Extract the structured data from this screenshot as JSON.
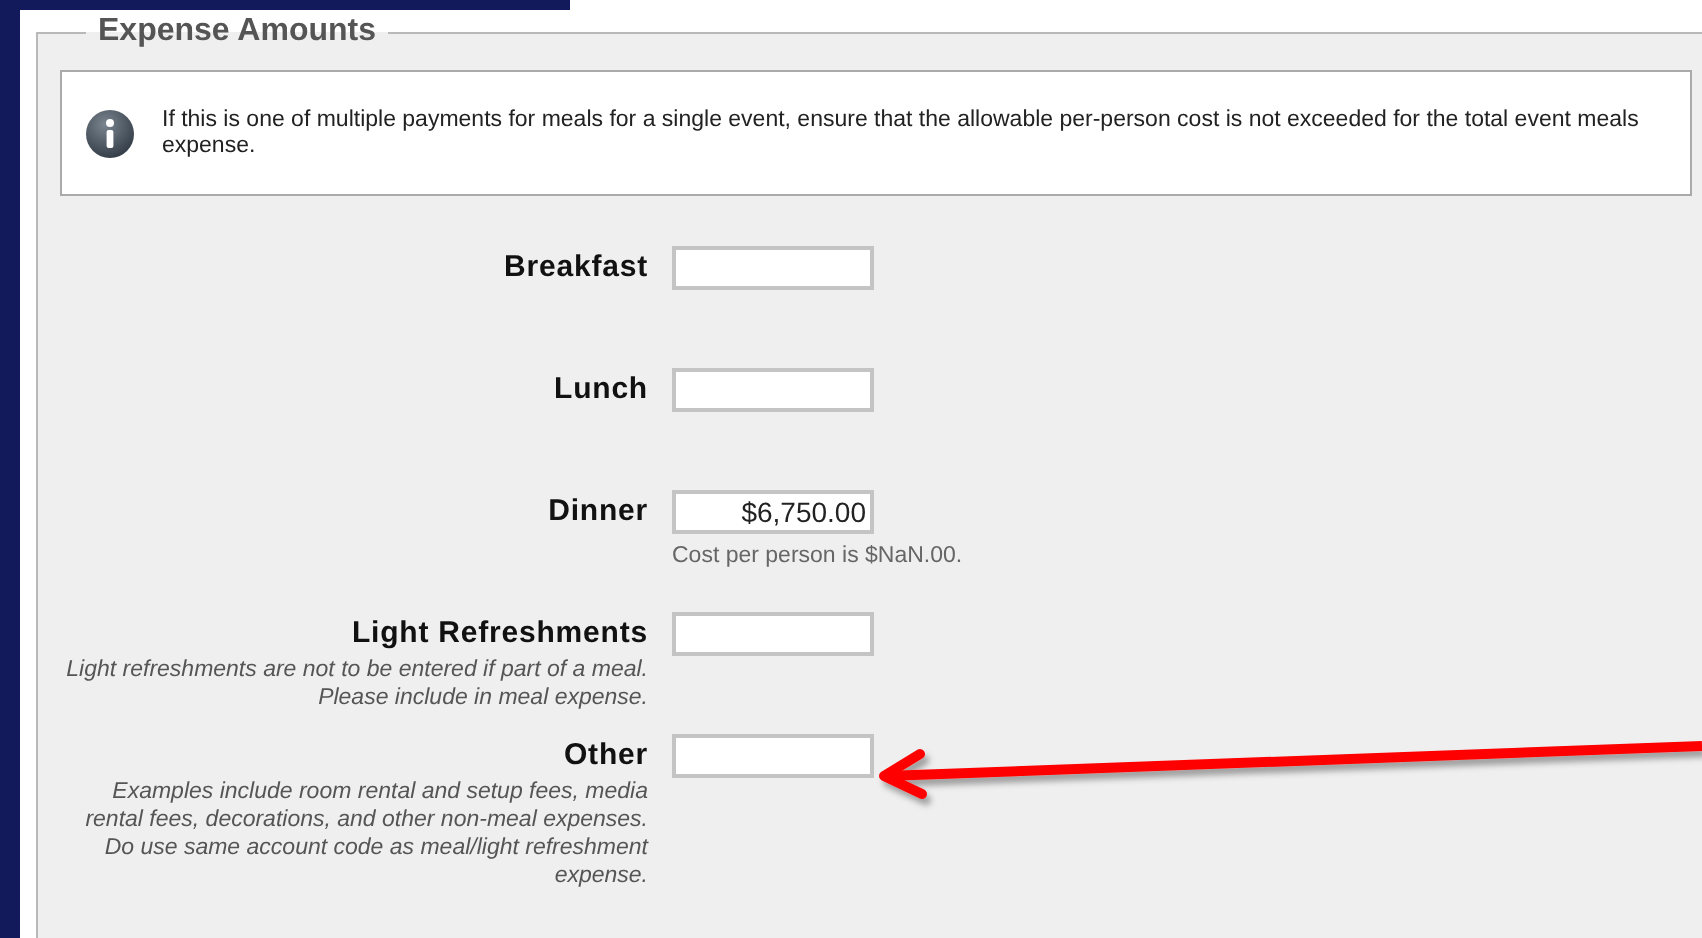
{
  "section": {
    "title": "Expense Amounts"
  },
  "info": {
    "text": "If this is one of multiple payments for meals for a single event, ensure that the allowable per-person cost is not exceeded for the total event meals expense."
  },
  "fields": [
    {
      "label": "Breakfast"
    },
    {
      "label": "Lunch"
    },
    {
      "label": "Dinner",
      "value": "$6,750.00",
      "note": "Cost per person is $NaN.00."
    },
    {
      "label": "Light Refreshments",
      "hint": "Light refreshments are not to be entered if part of a meal. Please include in meal expense."
    },
    {
      "label": "Other",
      "hint": "Examples include room rental and setup fees, media rental fees, decorations, and other non-meal expenses. Do use same account code as meal/light refreshment expense."
    }
  ]
}
